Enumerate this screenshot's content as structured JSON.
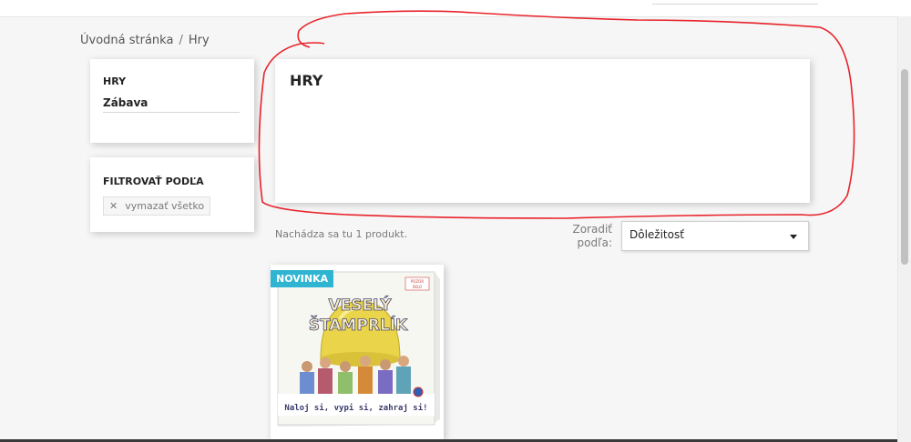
{
  "breadcrumb": {
    "items": [
      "Úvodná stránka",
      "Hry"
    ],
    "separator": "/"
  },
  "sidebar": {
    "category": {
      "title": "HRY",
      "subcategory": "Zábava"
    },
    "filter": {
      "title": "FILTROVAŤ PODĽA",
      "clear_label": "vymazať všetko"
    }
  },
  "main": {
    "title": "HRY",
    "product_count": "Nachádza sa tu 1 produkt.",
    "sort": {
      "label": "Zoradiť podľa:",
      "selected": "Dôležitosť"
    },
    "products": [
      {
        "badge": "NOVINKA",
        "box_title_line1": "VESELÝ",
        "box_title_line2": "ŠTAMPRLÍK",
        "box_tagline": "Naloj si, vypi si, zahraj si!",
        "box_corner_label": "POZOR",
        "box_corner_label2": "SKLO"
      }
    ]
  },
  "colors": {
    "accent": "#2fb5d2",
    "annotation": "#e8232b"
  },
  "icons": {
    "clear": "close-icon",
    "sort": "chevron-down-icon"
  }
}
